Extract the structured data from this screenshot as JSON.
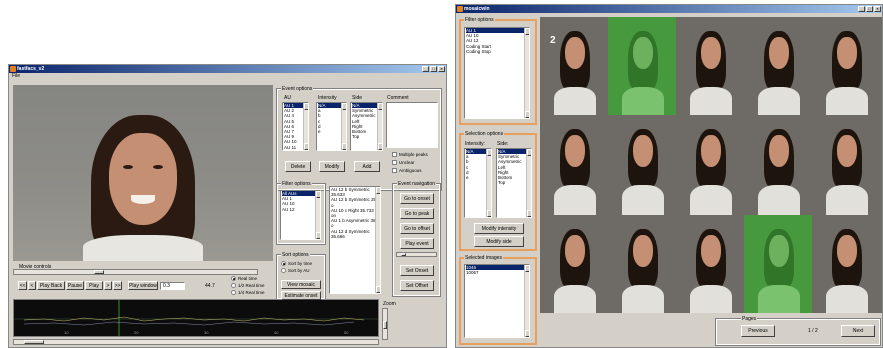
{
  "left_window": {
    "title": "fastfacs_v2",
    "menu": [
      "File"
    ],
    "window_buttons": [
      "_",
      "□",
      "×"
    ],
    "movie_controls": {
      "label": "Movie controls",
      "buttons": [
        "<<",
        "<",
        "Play Back",
        "Pause",
        "Play",
        ">",
        ">>"
      ],
      "play_window_label": "Play window",
      "play_window_value": "0.3",
      "time_value": "44.7",
      "speed_options": [
        "Real time",
        "1/2 Real time",
        "1/4 Real time"
      ],
      "speed_selected": 0
    },
    "timeline_ticks": [
      "10",
      "20",
      "30",
      "40",
      "50"
    ],
    "event_options": {
      "label": "Event options",
      "au_header": "AU",
      "au_items": [
        "AU 1",
        "AU 2",
        "AU 4",
        "AU 5",
        "AU 6",
        "AU 7",
        "AU 9",
        "AU 10",
        "AU 11"
      ],
      "intensity_header": "Intensity",
      "intensity_items": [
        "N/A",
        "a",
        "b",
        "c",
        "d",
        "e"
      ],
      "side_header": "Side",
      "side_items": [
        "N/A",
        "Symmetric",
        "Asymmetric",
        "Left",
        "Right",
        "Bottom",
        "Top"
      ],
      "comment_header": "Comment",
      "buttons": [
        "Delete",
        "Modify",
        "Add"
      ],
      "checks": [
        "Multiple peaks",
        "Unclear",
        "Ambiguous"
      ]
    },
    "filter_options": {
      "label": "Filter options",
      "items": [
        "All AUs",
        "AU 1",
        "AU 10",
        "AU 12"
      ],
      "events": [
        "AU 12 b Symmetric 35.633",
        "AU 12 b Symmetric 35.6 o",
        "AU 10 c Right 35.733 on",
        "AU 1 b Asymmetric 36.2 o",
        "AU 12 d Symmetric 36.666"
      ]
    },
    "sort_options": {
      "label": "Sort options",
      "options": [
        "Sort by time",
        "Sort by AU"
      ],
      "selected": 0,
      "buttons": [
        "View mosaic",
        "Estimate onset"
      ]
    },
    "event_navigation": {
      "label": "Event navigation",
      "buttons": [
        "Go to onset",
        "Go to peak",
        "Go to offset",
        "Play event",
        "Set Onset",
        "Set Offset"
      ]
    },
    "zoom_label": "Zoom"
  },
  "right_window": {
    "title": "mosaicwin",
    "window_buttons": [
      "_",
      "□",
      "×"
    ],
    "filter_options": {
      "label": "Filter options",
      "items": [
        "AU 1",
        "AU 10",
        "AU 12",
        "Coding Start",
        "Coding Stop"
      ],
      "selected": 0
    },
    "selection_options": {
      "label": "Selection options",
      "intensity_header": "Intensity:",
      "intensity_items": [
        "N/A",
        "a",
        "b",
        "c",
        "d",
        "e"
      ],
      "side_header": "Side:",
      "side_items": [
        "N/A",
        "Symmetric",
        "Asymmetric",
        "Left",
        "Right",
        "Bottom",
        "Top"
      ],
      "buttons": [
        "Modify intensity",
        "Modify side"
      ]
    },
    "selected_images": {
      "label": "Selected images",
      "items": [
        "1046",
        "10067"
      ]
    },
    "page_badge": "2",
    "pages": {
      "label": "Pages",
      "previous": "Previous",
      "indicator": "1 / 2",
      "next": "Next"
    },
    "highlighted_cells": [
      1,
      18
    ]
  },
  "colors": {
    "window_bg": "#d4d0c8",
    "titlebar": "#0a246a",
    "selection": "#0a246a",
    "panel_highlight": "#e8a060",
    "mosaic_highlight": "#4a8a3c"
  }
}
